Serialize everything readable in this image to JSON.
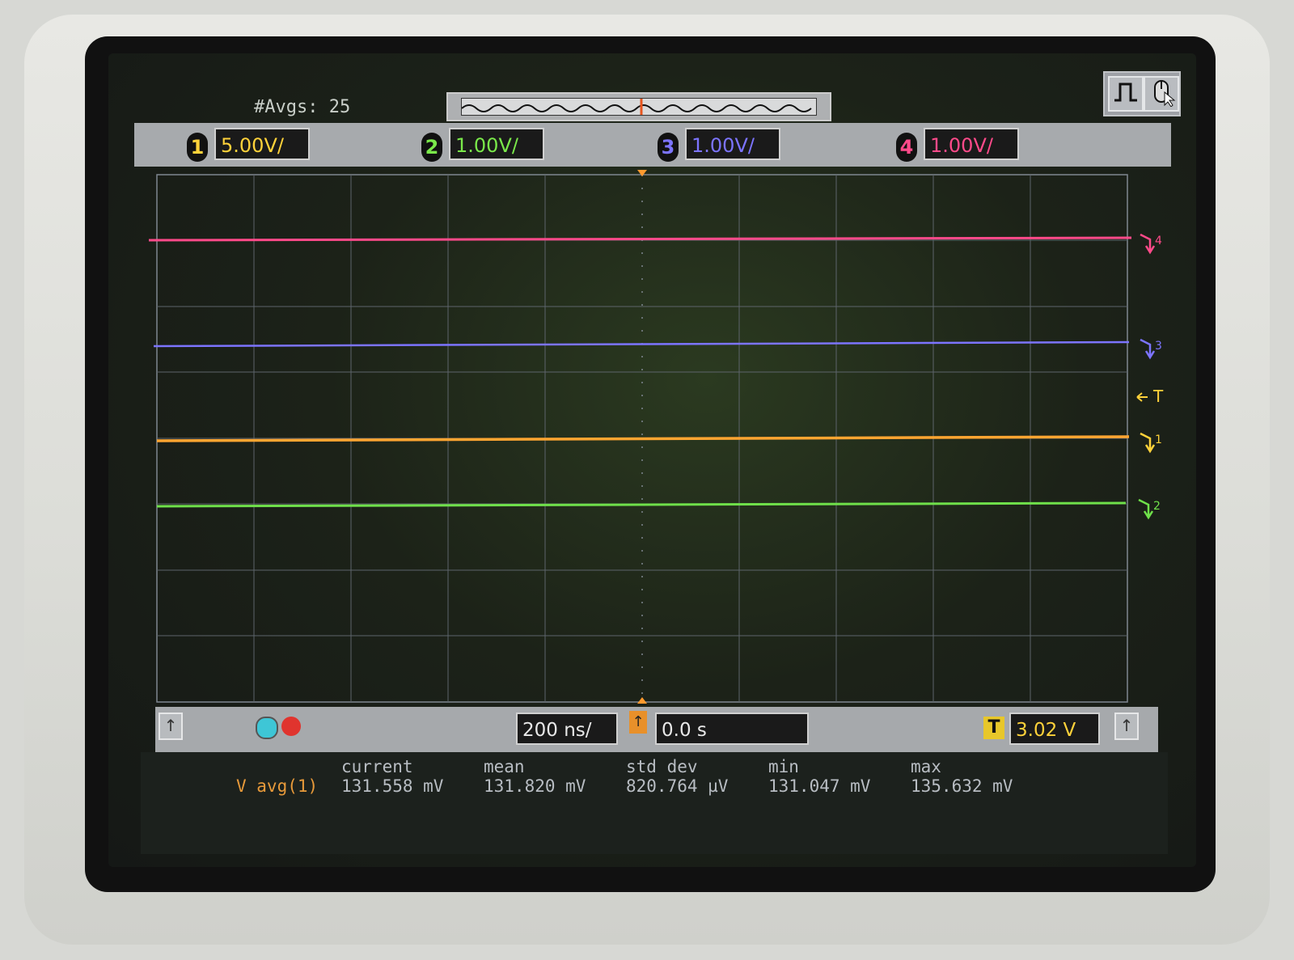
{
  "header": {
    "avgs_label": "#Avgs: 25"
  },
  "channels": [
    {
      "num": "1",
      "scale": "5.00V/",
      "color": "#ffd23a"
    },
    {
      "num": "2",
      "scale": "1.00V/",
      "color": "#7ae84a"
    },
    {
      "num": "3",
      "scale": "1.00V/",
      "color": "#7c74ff"
    },
    {
      "num": "4",
      "scale": "1.00V/",
      "color": "#ff4a8a"
    }
  ],
  "markers": {
    "ch4": "4",
    "ch3": "3",
    "trigger": "T",
    "ch1": "1",
    "ch2": "2"
  },
  "toolbar": {
    "icons": [
      "pulse-icon",
      "mouse-icon"
    ]
  },
  "bottom": {
    "timebase": "200 ns/",
    "delay": "0.0 s",
    "trigger_label": "T",
    "trigger_level": "3.02 V"
  },
  "measurements": {
    "label": "V avg(1)",
    "headers": [
      "current",
      "mean",
      "std dev",
      "min",
      "max"
    ],
    "values": [
      "131.558 mV",
      "131.820 mV",
      "820.764 µV",
      "131.047 mV",
      "135.632 mV"
    ]
  },
  "trace_colors": {
    "ch4": "#ff4a8a",
    "ch3": "#7c74ff",
    "ch1": "#ffa531",
    "ch2": "#6fe04a",
    "grid": "#7f8790",
    "marker_ch1": "#ffd23a"
  }
}
